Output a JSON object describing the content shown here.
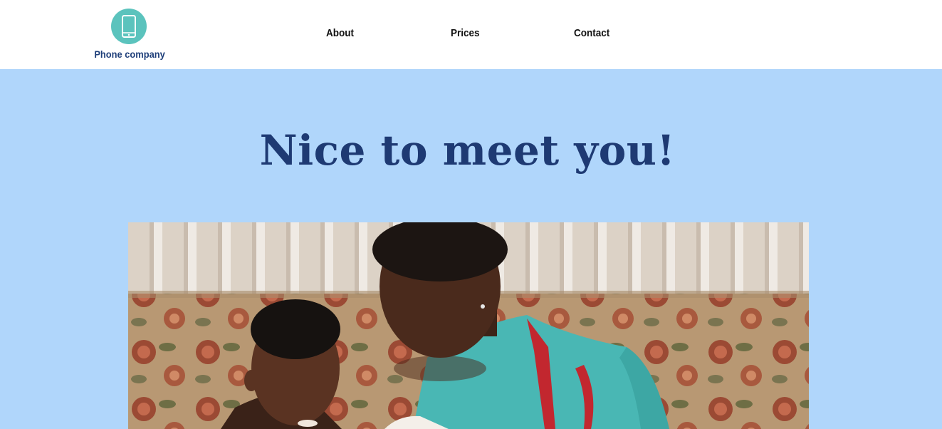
{
  "header": {
    "logo": {
      "icon": "smartphone-icon",
      "text": "Phone company",
      "circle_color": "#5bc3bd",
      "text_color": "#1f3f7a"
    },
    "nav": {
      "about_label": "About",
      "prices_label": "Prices",
      "contact_label": "Contact"
    }
  },
  "hero": {
    "title": "Nice to meet you!",
    "title_color": "#1e3a73",
    "background_color": "#b0d6fb",
    "image": "photo-father-and-son"
  }
}
